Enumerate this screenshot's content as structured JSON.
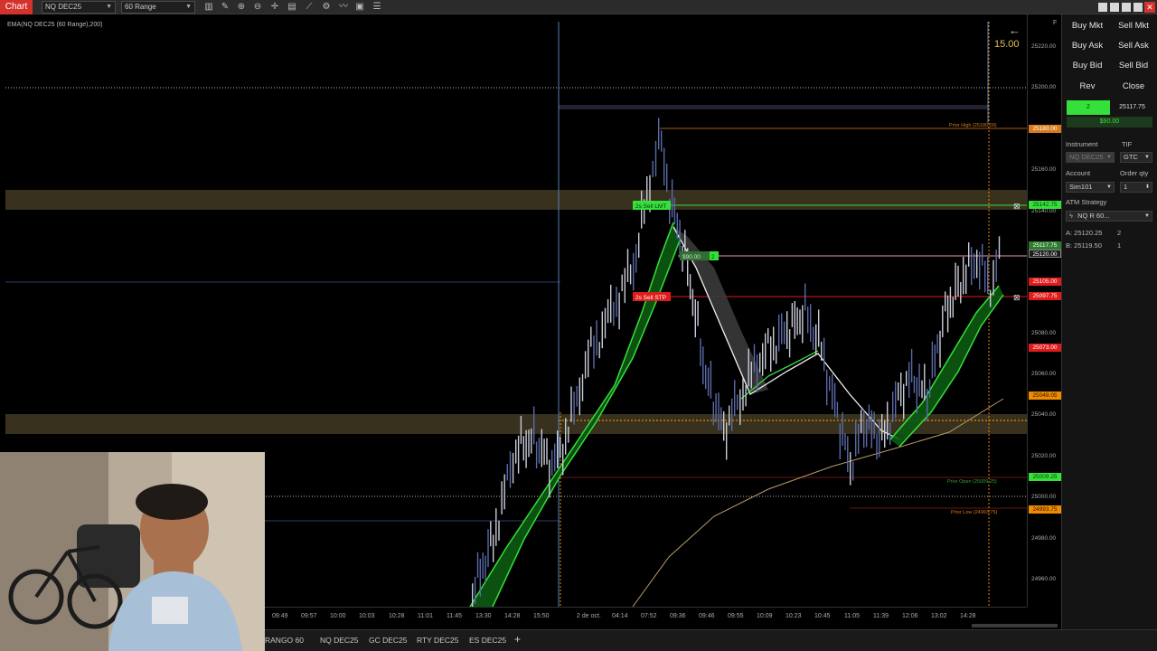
{
  "toolbar": {
    "tab_label": "Chart",
    "instrument_value": "NQ DEC25",
    "series_value": "60 Range"
  },
  "chart": {
    "indicator_label": "EMA(NQ DEC25 (60 Range),200)",
    "range_counter": "15.00",
    "order_labels": {
      "sell_lmt": "2s Sell LMT",
      "sell_stp": "2s Sell STP",
      "pnl_tag": "$90.00",
      "pnl_qty": "2"
    },
    "levels": {
      "prior_high": "Prior High (25180.00)",
      "prior_open": "Prior Open (25009.25)",
      "prior_low": "Prior Low (24993.75)"
    }
  },
  "price_axis": {
    "ticks": [
      "25220.00",
      "25200.00",
      "25160.00",
      "25140.00",
      "25080.00",
      "25060.00",
      "25040.00",
      "25020.00",
      "25000.00",
      "24980.00",
      "24960.00"
    ],
    "labels": {
      "prior_high": "25180.00",
      "sell_lmt": "25142.75",
      "position": "25117.75",
      "current": "25120.00",
      "stop_a": "25105.00",
      "sell_stp": "25097.75",
      "red_level": "25073.00",
      "orange_level": "25049.05",
      "prior_open": "25009.25",
      "prior_low": "24993.75"
    }
  },
  "time_axis": {
    "ticks": [
      "09:49",
      "09:57",
      "10:00",
      "10:03",
      "10:28",
      "11:01",
      "11:45",
      "13:30",
      "14:28",
      "15:50",
      "2 de oct.",
      "04:14",
      "07:52",
      "09:36",
      "09:46",
      "09:55",
      "10:09",
      "10:23",
      "10:45",
      "11:05",
      "11:39",
      "12:06",
      "13:02",
      "14:28"
    ]
  },
  "bottom_tabs": {
    "tabs": [
      "RANGO 60",
      "NQ DEC25",
      "GC DEC25",
      "RTY DEC25",
      "ES DEC25"
    ],
    "add_label": "+"
  },
  "panel": {
    "buttons": {
      "buy_mkt": "Buy Mkt",
      "sell_mkt": "Sell Mkt",
      "buy_ask": "Buy Ask",
      "sell_ask": "Sell Ask",
      "buy_bid": "Buy Bid",
      "sell_bid": "Sell Bid",
      "rev": "Rev",
      "close": "Close"
    },
    "position_qty": "2",
    "position_price": "25117.75",
    "unrealized": "$90.00",
    "instrument_label": "Instrument",
    "tif_label": "TIF",
    "instrument_value": "NQ DEC25",
    "tif_value": "GTC",
    "account_label": "Account",
    "order_qty_label": "Order qty",
    "account_value": "Sim101",
    "order_qty_value": "1",
    "atm_label": "ATM Strategy",
    "atm_value": "NQ R 60...",
    "ask_line": "A: 25120.25",
    "ask_size": "2",
    "bid_line": "B: 25119.50",
    "bid_size": "1"
  },
  "colors": {
    "accent_red": "#d4332b",
    "bull_green": "#35e03a",
    "sell_red": "#e01b1b",
    "orange": "#f08a00"
  }
}
